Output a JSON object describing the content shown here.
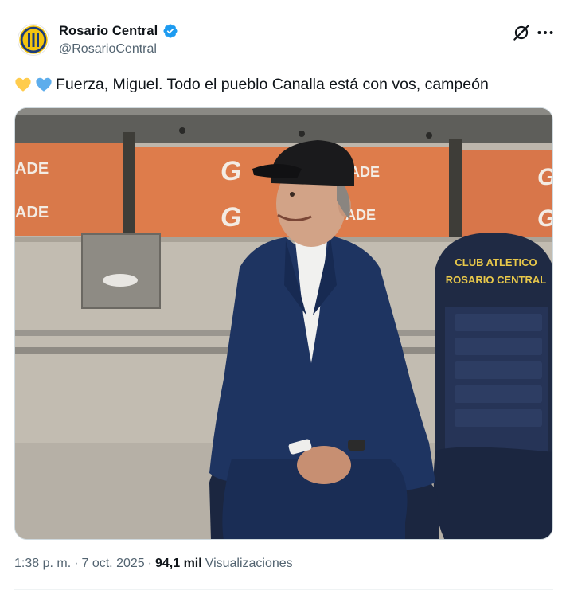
{
  "tweet": {
    "author": {
      "display_name": "Rosario Central",
      "handle": "@RosarioCentral",
      "verified": true
    },
    "emojis": [
      "yellow-heart",
      "blue-heart"
    ],
    "text": "Fuerza, Miguel. Todo el pueblo Canalla está con vos, campeón",
    "media": {
      "seat_text_line1": "CLUB ATLETICO",
      "seat_text_line2": "ROSARIO CENTRAL",
      "banner_fragments": [
        "ADE",
        "ADE",
        "ADE",
        "ADE"
      ]
    },
    "time": "1:38 p. m.",
    "separator": "·",
    "date": "7 oct. 2025",
    "views_count": "94,1 mil",
    "views_label": "Visualizaciones"
  },
  "colors": {
    "verified": "#1d9bf0",
    "yellow_heart": "#ffcc4d",
    "blue_heart": "#5dadec",
    "secondary_text": "#536471",
    "banner_orange": "#d9794a",
    "suit_navy": "#1e3461"
  }
}
